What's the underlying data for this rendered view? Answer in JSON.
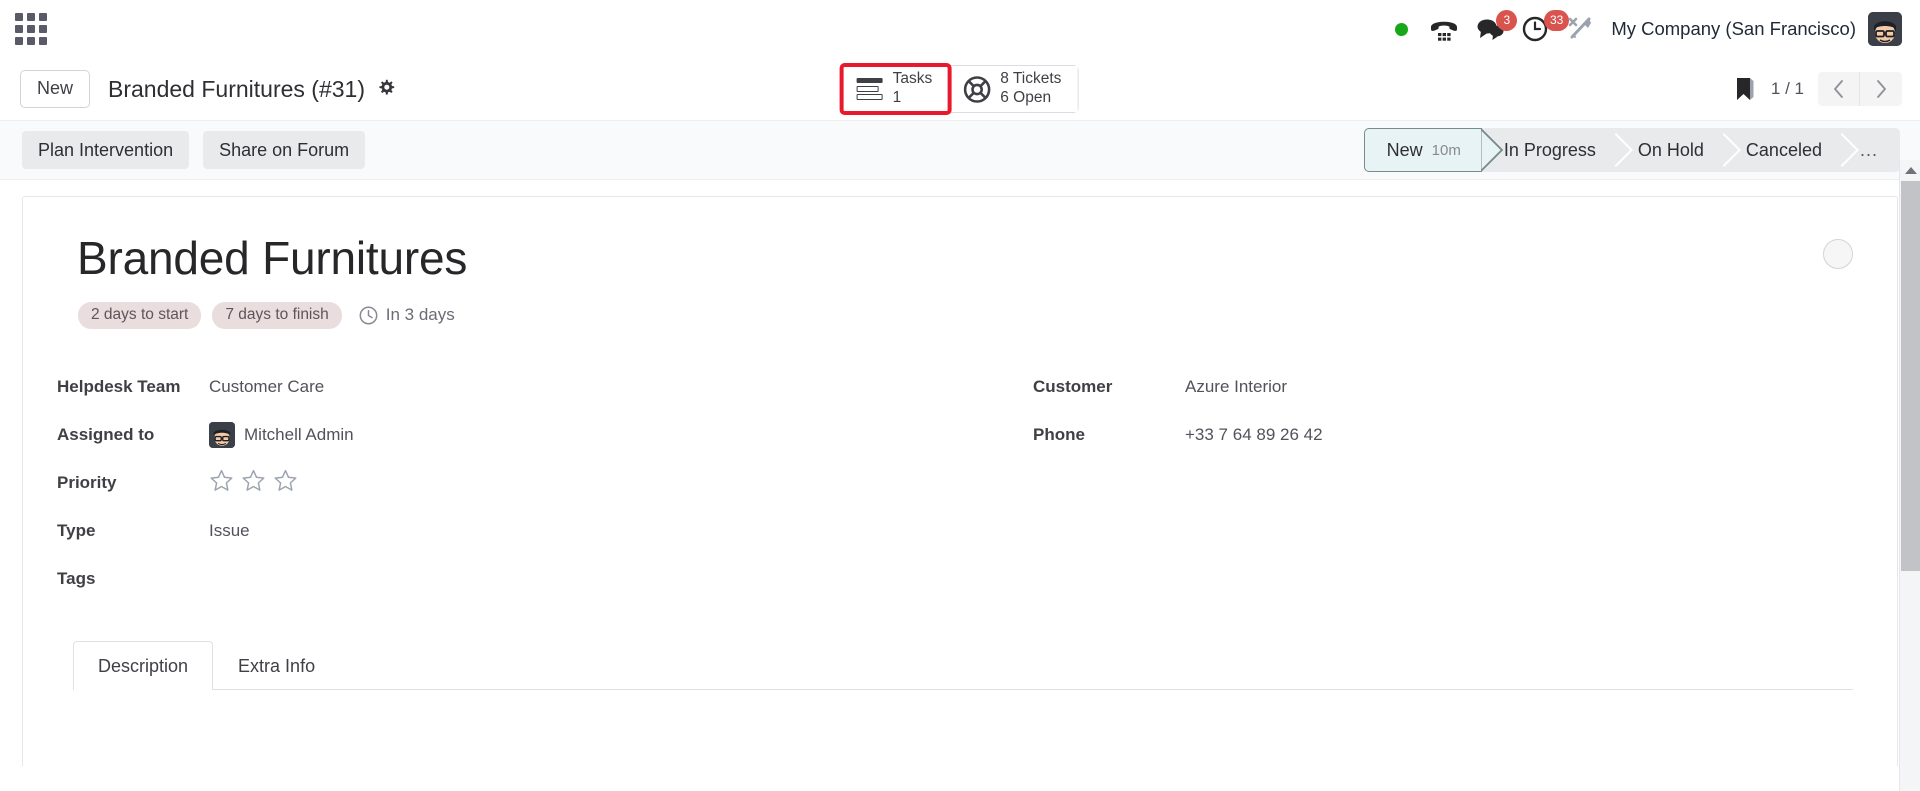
{
  "systray": {
    "apps_icon": "apps-grid-icon",
    "presence": {
      "name": "presence-dot",
      "color": "#17a81a"
    },
    "items": [
      {
        "name": "voip-phone-icon",
        "badge": null
      },
      {
        "name": "messaging-icon",
        "badge": "3"
      },
      {
        "name": "activities-clock-icon",
        "badge": "33"
      },
      {
        "name": "debug-tools-icon",
        "badge": null
      }
    ],
    "company": "My Company (San Francisco)",
    "avatar": "user-avatar"
  },
  "control_panel": {
    "new_label": "New",
    "breadcrumb": "Branded Furnitures (#31)",
    "gear_icon": "gear-icon",
    "stat_buttons": [
      {
        "icon": "tasks-list-icon",
        "line1": "Tasks",
        "line2": "1",
        "highlighted": true
      },
      {
        "icon": "lifebuoy-ticket-icon",
        "line1": "8 Tickets",
        "line2": "6 Open",
        "highlighted": false
      }
    ],
    "highlight_color": "#e8192c",
    "pager": {
      "value": "1 / 1",
      "prev": "‹",
      "next": "›",
      "bookmark_icon": "bookmark-icon"
    }
  },
  "action_bar": {
    "buttons": [
      {
        "label": "Plan Intervention"
      },
      {
        "label": "Share on Forum"
      }
    ],
    "stages": [
      {
        "label": "New",
        "duration": "10m",
        "selected": true
      },
      {
        "label": "In Progress",
        "duration": "",
        "selected": false
      },
      {
        "label": "On Hold",
        "duration": "",
        "selected": false
      },
      {
        "label": "Canceled",
        "duration": "",
        "selected": false
      },
      {
        "label": "...",
        "duration": "",
        "selected": false
      }
    ]
  },
  "form": {
    "title": "Branded Furnitures",
    "pills": [
      "2 days to start",
      "7 days to finish"
    ],
    "deadline": {
      "icon": "clock-icon",
      "text": "In 3 days"
    },
    "avatar_placeholder": "assignee-avatar-placeholder",
    "left_fields": [
      {
        "label": "Helpdesk Team",
        "value": "Customer Care",
        "kind": "text"
      },
      {
        "label": "Assigned to",
        "value": "Mitchell Admin",
        "kind": "avatar-text"
      },
      {
        "label": "Priority",
        "value": "",
        "kind": "stars",
        "stars": 3,
        "filled": 0
      },
      {
        "label": "Type",
        "value": "Issue",
        "kind": "text"
      },
      {
        "label": "Tags",
        "value": "",
        "kind": "text"
      }
    ],
    "right_fields": [
      {
        "label": "Customer",
        "value": "Azure Interior",
        "kind": "text"
      },
      {
        "label": "Phone",
        "value": "+33 7 64 89 26 42",
        "kind": "text"
      }
    ],
    "tabs": [
      {
        "label": "Description",
        "active": true
      },
      {
        "label": "Extra Info",
        "active": false
      }
    ]
  }
}
